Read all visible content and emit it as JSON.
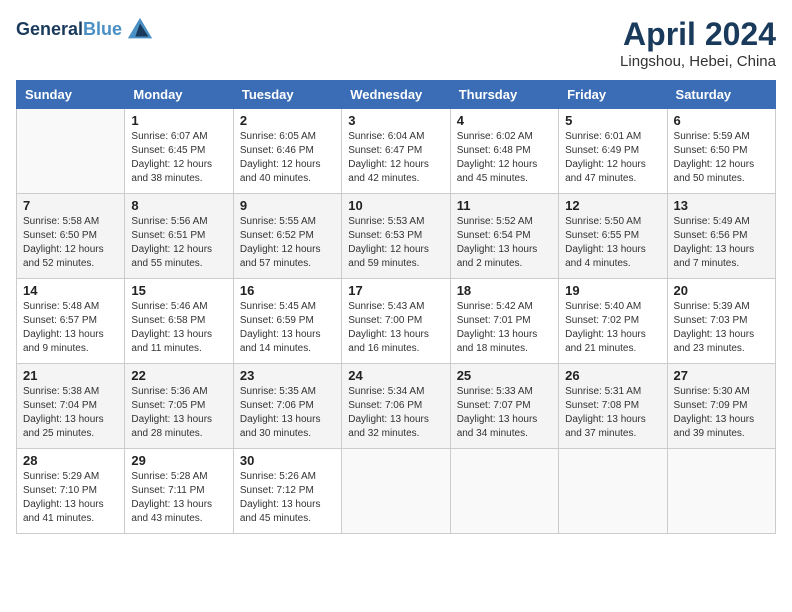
{
  "header": {
    "logo_line1": "General",
    "logo_line2": "Blue",
    "month": "April 2024",
    "location": "Lingshou, Hebei, China"
  },
  "weekdays": [
    "Sunday",
    "Monday",
    "Tuesday",
    "Wednesday",
    "Thursday",
    "Friday",
    "Saturday"
  ],
  "weeks": [
    [
      {
        "day": "",
        "sunrise": "",
        "sunset": "",
        "daylight": ""
      },
      {
        "day": "1",
        "sunrise": "Sunrise: 6:07 AM",
        "sunset": "Sunset: 6:45 PM",
        "daylight": "Daylight: 12 hours and 38 minutes."
      },
      {
        "day": "2",
        "sunrise": "Sunrise: 6:05 AM",
        "sunset": "Sunset: 6:46 PM",
        "daylight": "Daylight: 12 hours and 40 minutes."
      },
      {
        "day": "3",
        "sunrise": "Sunrise: 6:04 AM",
        "sunset": "Sunset: 6:47 PM",
        "daylight": "Daylight: 12 hours and 42 minutes."
      },
      {
        "day": "4",
        "sunrise": "Sunrise: 6:02 AM",
        "sunset": "Sunset: 6:48 PM",
        "daylight": "Daylight: 12 hours and 45 minutes."
      },
      {
        "day": "5",
        "sunrise": "Sunrise: 6:01 AM",
        "sunset": "Sunset: 6:49 PM",
        "daylight": "Daylight: 12 hours and 47 minutes."
      },
      {
        "day": "6",
        "sunrise": "Sunrise: 5:59 AM",
        "sunset": "Sunset: 6:50 PM",
        "daylight": "Daylight: 12 hours and 50 minutes."
      }
    ],
    [
      {
        "day": "7",
        "sunrise": "Sunrise: 5:58 AM",
        "sunset": "Sunset: 6:50 PM",
        "daylight": "Daylight: 12 hours and 52 minutes."
      },
      {
        "day": "8",
        "sunrise": "Sunrise: 5:56 AM",
        "sunset": "Sunset: 6:51 PM",
        "daylight": "Daylight: 12 hours and 55 minutes."
      },
      {
        "day": "9",
        "sunrise": "Sunrise: 5:55 AM",
        "sunset": "Sunset: 6:52 PM",
        "daylight": "Daylight: 12 hours and 57 minutes."
      },
      {
        "day": "10",
        "sunrise": "Sunrise: 5:53 AM",
        "sunset": "Sunset: 6:53 PM",
        "daylight": "Daylight: 12 hours and 59 minutes."
      },
      {
        "day": "11",
        "sunrise": "Sunrise: 5:52 AM",
        "sunset": "Sunset: 6:54 PM",
        "daylight": "Daylight: 13 hours and 2 minutes."
      },
      {
        "day": "12",
        "sunrise": "Sunrise: 5:50 AM",
        "sunset": "Sunset: 6:55 PM",
        "daylight": "Daylight: 13 hours and 4 minutes."
      },
      {
        "day": "13",
        "sunrise": "Sunrise: 5:49 AM",
        "sunset": "Sunset: 6:56 PM",
        "daylight": "Daylight: 13 hours and 7 minutes."
      }
    ],
    [
      {
        "day": "14",
        "sunrise": "Sunrise: 5:48 AM",
        "sunset": "Sunset: 6:57 PM",
        "daylight": "Daylight: 13 hours and 9 minutes."
      },
      {
        "day": "15",
        "sunrise": "Sunrise: 5:46 AM",
        "sunset": "Sunset: 6:58 PM",
        "daylight": "Daylight: 13 hours and 11 minutes."
      },
      {
        "day": "16",
        "sunrise": "Sunrise: 5:45 AM",
        "sunset": "Sunset: 6:59 PM",
        "daylight": "Daylight: 13 hours and 14 minutes."
      },
      {
        "day": "17",
        "sunrise": "Sunrise: 5:43 AM",
        "sunset": "Sunset: 7:00 PM",
        "daylight": "Daylight: 13 hours and 16 minutes."
      },
      {
        "day": "18",
        "sunrise": "Sunrise: 5:42 AM",
        "sunset": "Sunset: 7:01 PM",
        "daylight": "Daylight: 13 hours and 18 minutes."
      },
      {
        "day": "19",
        "sunrise": "Sunrise: 5:40 AM",
        "sunset": "Sunset: 7:02 PM",
        "daylight": "Daylight: 13 hours and 21 minutes."
      },
      {
        "day": "20",
        "sunrise": "Sunrise: 5:39 AM",
        "sunset": "Sunset: 7:03 PM",
        "daylight": "Daylight: 13 hours and 23 minutes."
      }
    ],
    [
      {
        "day": "21",
        "sunrise": "Sunrise: 5:38 AM",
        "sunset": "Sunset: 7:04 PM",
        "daylight": "Daylight: 13 hours and 25 minutes."
      },
      {
        "day": "22",
        "sunrise": "Sunrise: 5:36 AM",
        "sunset": "Sunset: 7:05 PM",
        "daylight": "Daylight: 13 hours and 28 minutes."
      },
      {
        "day": "23",
        "sunrise": "Sunrise: 5:35 AM",
        "sunset": "Sunset: 7:06 PM",
        "daylight": "Daylight: 13 hours and 30 minutes."
      },
      {
        "day": "24",
        "sunrise": "Sunrise: 5:34 AM",
        "sunset": "Sunset: 7:06 PM",
        "daylight": "Daylight: 13 hours and 32 minutes."
      },
      {
        "day": "25",
        "sunrise": "Sunrise: 5:33 AM",
        "sunset": "Sunset: 7:07 PM",
        "daylight": "Daylight: 13 hours and 34 minutes."
      },
      {
        "day": "26",
        "sunrise": "Sunrise: 5:31 AM",
        "sunset": "Sunset: 7:08 PM",
        "daylight": "Daylight: 13 hours and 37 minutes."
      },
      {
        "day": "27",
        "sunrise": "Sunrise: 5:30 AM",
        "sunset": "Sunset: 7:09 PM",
        "daylight": "Daylight: 13 hours and 39 minutes."
      }
    ],
    [
      {
        "day": "28",
        "sunrise": "Sunrise: 5:29 AM",
        "sunset": "Sunset: 7:10 PM",
        "daylight": "Daylight: 13 hours and 41 minutes."
      },
      {
        "day": "29",
        "sunrise": "Sunrise: 5:28 AM",
        "sunset": "Sunset: 7:11 PM",
        "daylight": "Daylight: 13 hours and 43 minutes."
      },
      {
        "day": "30",
        "sunrise": "Sunrise: 5:26 AM",
        "sunset": "Sunset: 7:12 PM",
        "daylight": "Daylight: 13 hours and 45 minutes."
      },
      {
        "day": "",
        "sunrise": "",
        "sunset": "",
        "daylight": ""
      },
      {
        "day": "",
        "sunrise": "",
        "sunset": "",
        "daylight": ""
      },
      {
        "day": "",
        "sunrise": "",
        "sunset": "",
        "daylight": ""
      },
      {
        "day": "",
        "sunrise": "",
        "sunset": "",
        "daylight": ""
      }
    ]
  ]
}
